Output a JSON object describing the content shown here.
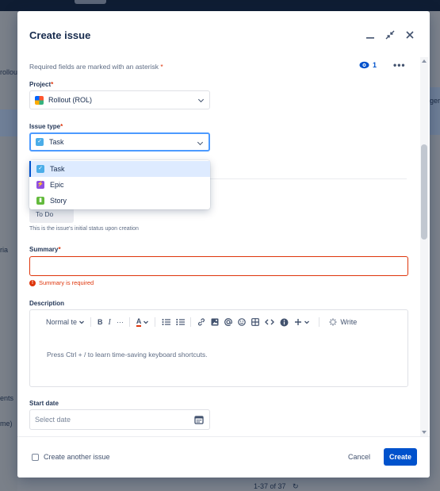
{
  "background": {
    "left_texts": [
      "rollou",
      "ria",
      "ents",
      "me)"
    ],
    "right_text": "ger",
    "footer_pagination": "1-37 of 37",
    "refresh_glyph": "↻"
  },
  "modal": {
    "title": "Create issue",
    "header_icons": [
      "minimize-icon",
      "collapse-icon",
      "close-icon"
    ],
    "required_note": "Required fields are marked with an asterisk",
    "asterisk": "*",
    "watchers_count": "1",
    "more_glyph": "•••"
  },
  "project": {
    "label": "Project",
    "value": "Rollout (ROL)"
  },
  "issue_type": {
    "label": "Issue type",
    "value": "Task",
    "options": [
      {
        "label": "Task",
        "icon": "task-icon",
        "color": "#4bade8",
        "active": true
      },
      {
        "label": "Epic",
        "icon": "epic-icon",
        "color": "#904ee2",
        "active": false
      },
      {
        "label": "Story",
        "icon": "story-icon",
        "color": "#63ba3c",
        "active": false
      }
    ]
  },
  "status": {
    "value": "To Do",
    "helper": "This is the issue's initial status upon creation"
  },
  "summary": {
    "label": "Summary",
    "value": "",
    "error": "Summary is required"
  },
  "description": {
    "label": "Description",
    "text_style": "Normal te",
    "bold": "B",
    "italic": "I",
    "more_formatting": "···",
    "text_color": "A",
    "write_label": "Write",
    "placeholder": "Press Ctrl + / to learn time-saving keyboard shortcuts."
  },
  "start_date": {
    "label": "Start date",
    "placeholder": "Select date"
  },
  "footer": {
    "create_another_label": "Create another issue",
    "cancel_label": "Cancel",
    "create_label": "Create"
  },
  "colors": {
    "primary": "#0052cc",
    "error": "#de350b",
    "focus": "#4c9aff"
  }
}
